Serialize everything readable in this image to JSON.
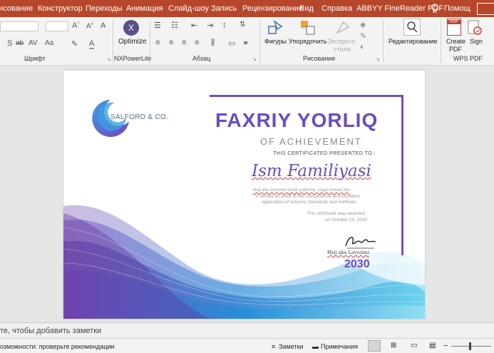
{
  "tabs": [
    "исование",
    "Конструктор",
    "Переходы",
    "Анимация",
    "Слайд-шоу",
    "Запись",
    "Рецензирование",
    "Вид",
    "Справка",
    "ABBYY FineReader PDF",
    "Помощ"
  ],
  "ribbon": {
    "font_group": "Шрифт",
    "nxpower_group": "NXPowerLite",
    "paragraph_group": "Абзац",
    "drawing_group": "Рисование",
    "wps_group": "WPS PDF",
    "optimize": "Optimize",
    "shapes": "Фигуры",
    "arrange": "Упорядочить",
    "express_styles_1": "Экспресс-",
    "express_styles_2": "стили",
    "editing": "Редактирование",
    "create_pdf_1": "Create",
    "create_pdf_2": "PDF",
    "sign": "Sign",
    "pdf_badge": "PDF"
  },
  "certificate": {
    "logo_text": "SALFORD & CO.",
    "title": "FAXRIY YORLIQ",
    "subtitle": "OF ACHIEVEMENT",
    "presented": "THIS CERTIFICATED PRESENTED TO :",
    "name": "Ism Familiyasi",
    "body_1": "Hoji aka shunisini bosib yuborinq, sizga mosda shu",
    "body_2": "It serves as proof of her competence and excellent",
    "body_3": "application of industry standards and methods.",
    "award_1": "This certificate was awarded",
    "award_2": "on October 25, 2030",
    "signer": "Hoji aka Lavozimi",
    "year": "2030"
  },
  "notes": {
    "placeholder": "те, чтобы добавить заметки"
  },
  "status": {
    "accessibility": "озможности: проверьте рекомендации",
    "notes_btn": "Заметки",
    "comments_btn": "Примечания"
  },
  "colors": {
    "accent": "#b7472a",
    "purple": "#6a4bc4",
    "frame": "#7a4dc4",
    "blue": "#2aa3d8"
  }
}
